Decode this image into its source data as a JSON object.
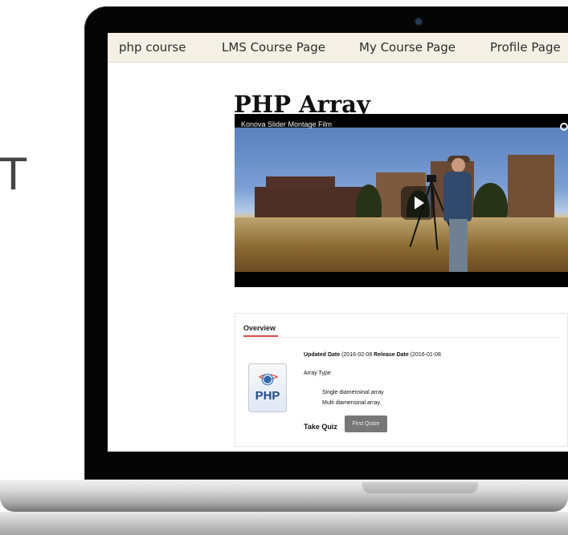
{
  "hero": {
    "left_letter": "T"
  },
  "nav": {
    "items": [
      "php course",
      "LMS Course Page",
      "My Course Page",
      "Profile Page"
    ]
  },
  "page": {
    "title": "PHP Array"
  },
  "video": {
    "caption": "Konova Slider Montage Film"
  },
  "overview": {
    "tab_label": "Overview",
    "updated_label": "Updated Date",
    "updated_value": "(2016-02-08",
    "release_label": "Release Date",
    "release_value": "(2016-01-08",
    "array_type_label": "Array Type",
    "items": [
      "Single diamensinal array",
      "Multi diamensinal array."
    ],
    "quiz_label": "Take Quiz",
    "quiz_button": "First Quize"
  },
  "logo": {
    "text": "PHP"
  },
  "icons": {
    "play": "play-icon",
    "video_corner": "clock-icon",
    "logo_symbol": "php-icon"
  }
}
